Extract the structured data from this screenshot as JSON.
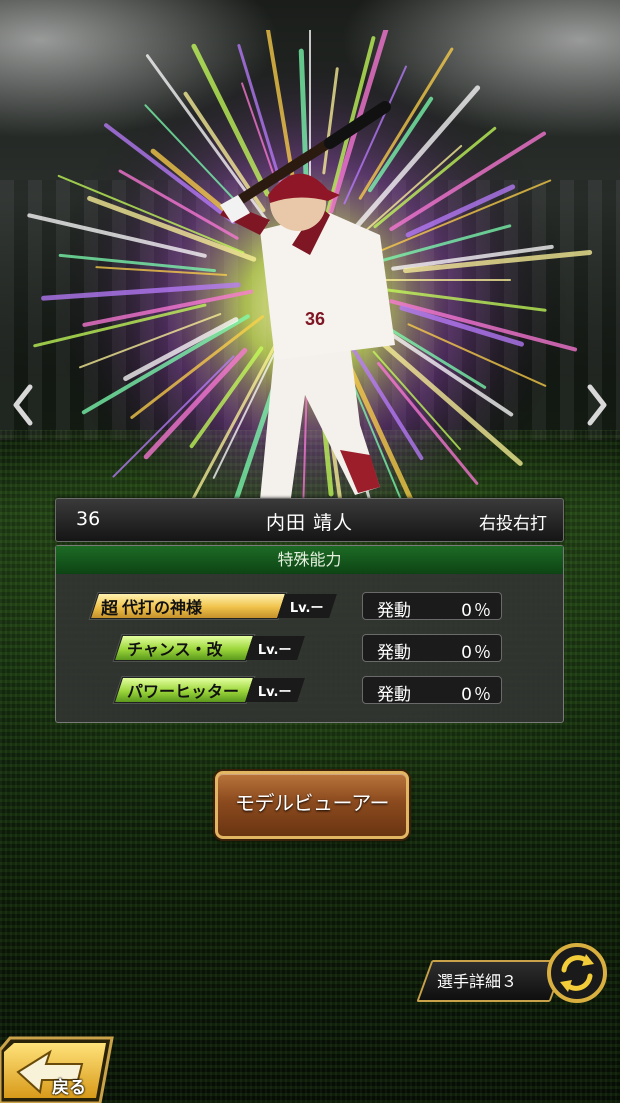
{
  "player": {
    "number": "36",
    "name": "内田 靖人",
    "throw_bat": "右投右打"
  },
  "abilities": {
    "header": "特殊能力",
    "items": [
      {
        "prefix": "超",
        "name": "代打の神様",
        "level": "Lv.ー",
        "status_label": "発動",
        "rate": "0％",
        "tier": "gold"
      },
      {
        "prefix": "",
        "name": "チャンス・改",
        "level": "Lv.ー",
        "status_label": "発動",
        "rate": "0％",
        "tier": "green"
      },
      {
        "prefix": "",
        "name": "パワーヒッター",
        "level": "Lv.ー",
        "status_label": "発動",
        "rate": "0％",
        "tier": "green"
      }
    ]
  },
  "buttons": {
    "model_viewer": "モデルビューアー",
    "player_detail": "選手詳細３",
    "back": "戻る"
  },
  "colors": {
    "gold_badge": "#f0c24a",
    "green_badge": "#9bd63a",
    "ability_header": "#1d6b25",
    "button_brown": "#8b4a1e",
    "button_border": "#e2b663"
  },
  "icons": {
    "left": "chevron-left-icon",
    "right": "chevron-right-icon",
    "cycle": "cycle-arrows-icon",
    "back": "back-arrow-icon"
  }
}
